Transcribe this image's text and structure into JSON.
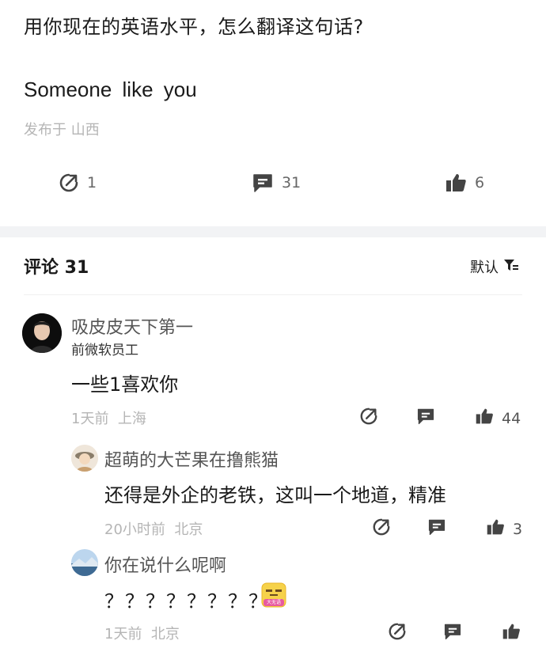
{
  "question": {
    "title": "用你现在的英语水平，怎么翻译这句话?",
    "body": "Someone like you",
    "location": "发布于 山西",
    "stats": {
      "shares": "1",
      "comments": "31",
      "likes": "6"
    }
  },
  "comments_header": {
    "label": "评论 31",
    "sort_label": "默认"
  },
  "comments": [
    {
      "username": "吸皮皮天下第一",
      "badge": "前微软员工",
      "text": "一些1喜欢你",
      "time": "1天前",
      "location": "上海",
      "likes": "44"
    }
  ],
  "replies": [
    {
      "username": "超萌的大芒果在撸熊猫",
      "text": "还得是外企的老铁，这叫一个地道，精准",
      "time": "20小时前",
      "location": "北京",
      "likes": "3"
    },
    {
      "username": "你在说什么呢啊",
      "text": "？？？？？？？？",
      "sticker_text": "大无语",
      "time": "1天前",
      "location": "北京",
      "likes": ""
    }
  ],
  "colors": {
    "icon": "#444444",
    "muted": "#b5b5b5",
    "band": "#f2f3f5"
  }
}
